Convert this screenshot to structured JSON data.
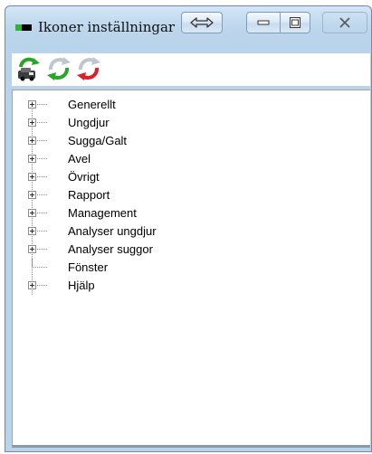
{
  "window": {
    "title": "Ikoner inställningar"
  },
  "titlebar_buttons": [
    {
      "name": "swap-arrows-icon",
      "role": "swap"
    },
    {
      "name": "minimize-icon",
      "role": "minimize"
    },
    {
      "name": "maximize-icon",
      "role": "maximize"
    },
    {
      "name": "close-icon",
      "role": "close"
    }
  ],
  "toolbar": {
    "buttons": [
      {
        "icon": "car-sync-icon"
      },
      {
        "icon": "green-sync-icon"
      },
      {
        "icon": "red-sync-icon"
      }
    ]
  },
  "tree": {
    "items": [
      {
        "label": "Generellt",
        "expandable": true
      },
      {
        "label": "Ungdjur",
        "expandable": true
      },
      {
        "label": "Sugga/Galt",
        "expandable": true
      },
      {
        "label": "Avel",
        "expandable": true
      },
      {
        "label": "Övrigt",
        "expandable": true
      },
      {
        "label": "Rapport",
        "expandable": true
      },
      {
        "label": "Management",
        "expandable": true
      },
      {
        "label": "Analyser ungdjur",
        "expandable": true
      },
      {
        "label": "Analyser suggor",
        "expandable": true
      },
      {
        "label": "Fönster",
        "expandable": false
      },
      {
        "label": "Hjälp",
        "expandable": true
      }
    ]
  },
  "colors": {
    "titlebar": "#c2d9ee",
    "app_icon_accent": "#2fb52f",
    "sync_green": "#2aa52a",
    "sync_red": "#d8232a"
  }
}
